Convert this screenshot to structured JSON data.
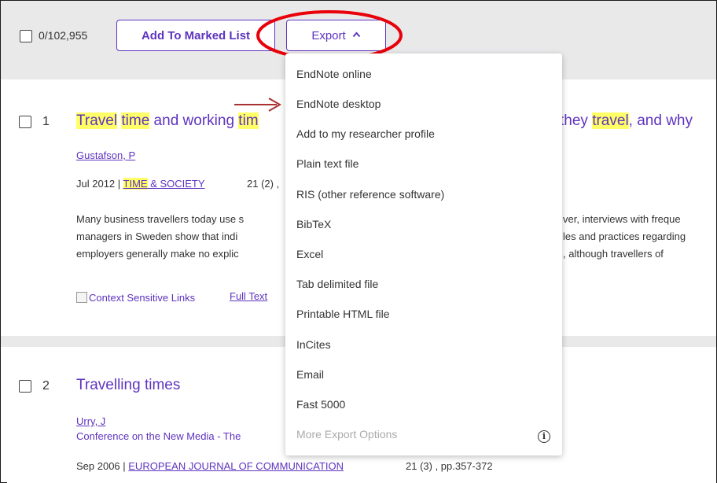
{
  "toolbar": {
    "count": "0/102,955",
    "marked_list_label": "Add To Marked List",
    "export_label": "Export",
    "export_chevron": "^"
  },
  "export_menu": {
    "items": [
      "EndNote online",
      "EndNote desktop",
      "Add to my researcher profile",
      "Plain text file",
      "RIS (other reference software)",
      "BibTeX",
      "Excel",
      "Tab delimited file",
      "Printable HTML file",
      "InCites",
      "Email",
      "Fast 5000",
      "More Export Options"
    ],
    "info_glyph": "i"
  },
  "records": [
    {
      "number": "1",
      "title_parts": [
        "Travel",
        " ",
        "time",
        " and working ",
        "tim",
        "they ",
        "travel",
        ", and why"
      ],
      "author": "Gustafson, P",
      "date": "Jul 2012 | ",
      "journal_hl": "TIME",
      "journal_rest": " & SOCIETY",
      "volume": "21 (2) ,",
      "abstract_left": [
        "Many business travellers today use s",
        "managers in Sweden show that indi",
        "employers generally make no explic"
      ],
      "abstract_right": [
        "ver, interviews with freque",
        "les and practices regarding",
        ", although travellers of"
      ],
      "context_links": "Context Sensitive Links",
      "full_text": "Full Text"
    },
    {
      "number": "2",
      "title": "Travelling times",
      "author": "Urry, J",
      "conference": "Conference on the New Media - The",
      "date": "Sep 2006 | ",
      "journal": "EUROPEAN JOURNAL OF COMMUNICATION",
      "volume": "21 (3) , pp.357-372"
    }
  ],
  "colors": {
    "accent": "#5e33bf",
    "highlight": "#ffff66",
    "annotation_red": "#e8000a",
    "arrow": "#a83232"
  }
}
